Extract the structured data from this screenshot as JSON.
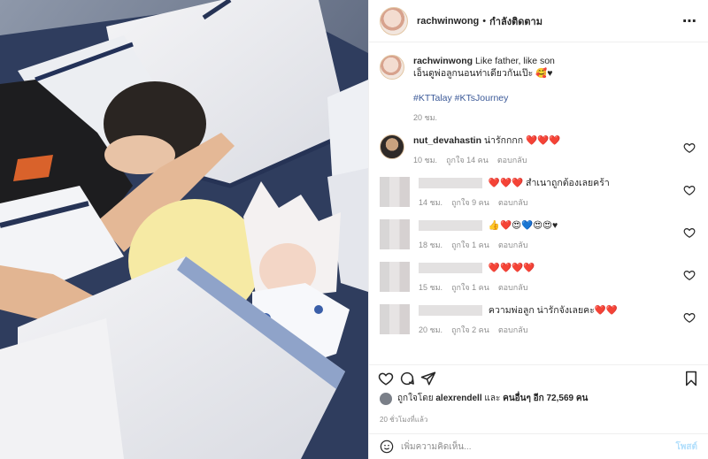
{
  "header": {
    "username": "rachwinwong",
    "separator": "•",
    "follow_status": "กำลังติดตาม",
    "more_icon": "more-horizontal-icon"
  },
  "caption": {
    "username": "rachwinwong",
    "text": "Like father, like son",
    "line2": "เอ็นดูพ่อลูกนอนท่าเดียวกันเป๊ะ 🥰♥",
    "hashtags": "#KTTalay #KTsJourney",
    "time": "20 ชม."
  },
  "comments": [
    {
      "username": "nut_devahastin",
      "text": "น่ารักกกก ❤️❤️❤️",
      "time": "10 ชม.",
      "likes": "ถูกใจ 14 คน",
      "reply": "ตอบกลับ"
    },
    {
      "username": "",
      "text": "❤️❤️❤️ สำเนาถูกต้องเลยคร้า",
      "time": "14 ชม.",
      "likes": "ถูกใจ 9 คน",
      "reply": "ตอบกลับ"
    },
    {
      "username": "",
      "text": "👍❤️😍💙😍😍♥",
      "time": "18 ชม.",
      "likes": "ถูกใจ 1 คน",
      "reply": "ตอบกลับ"
    },
    {
      "username": "",
      "text": "❤️❤️❤️❤️",
      "time": "15 ชม.",
      "likes": "ถูกใจ 1 คน",
      "reply": "ตอบกลับ"
    },
    {
      "username": "",
      "text": "ความพ่อลูก น่ารักจังเลยคะ❤️❤️",
      "time": "20 ชม.",
      "likes": "ถูกใจ 2 คน",
      "reply": "ตอบกลับ"
    }
  ],
  "likes": {
    "prefix": "ถูกใจโดย",
    "user": "alexrendell",
    "middle": "และ",
    "others": "คนอื่นๆ อีก 72,569 คน"
  },
  "posted_ago": "20 ชั่วโมงที่แล้ว",
  "add_comment": {
    "placeholder": "เพิ่มความคิดเห็น...",
    "post_label": "โพสต์"
  },
  "icons": {
    "like": "heart-icon",
    "comment": "comment-icon",
    "share": "share-icon",
    "save": "bookmark-icon",
    "emoji": "emoji-icon"
  }
}
